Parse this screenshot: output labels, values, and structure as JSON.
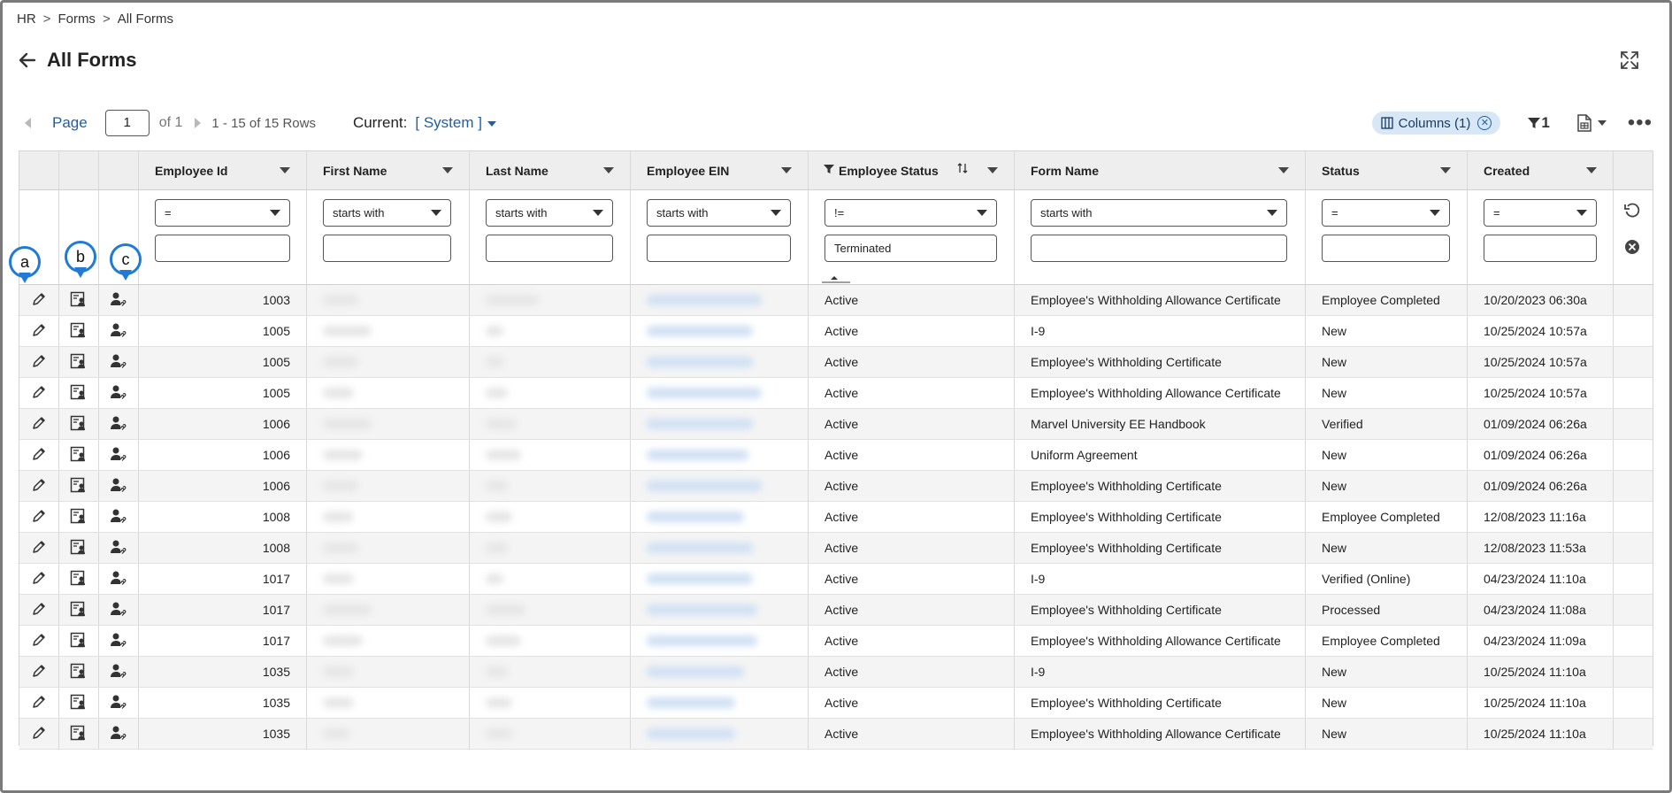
{
  "breadcrumb": [
    "HR",
    "Forms",
    "All Forms"
  ],
  "breadcrumb_sep": ">",
  "page_title": "All Forms",
  "pagination": {
    "page_label": "Page",
    "page_value": "1",
    "of_label": "of 1",
    "rows_label": "1 - 15 of 15 Rows"
  },
  "view": {
    "current_label": "Current:",
    "current_value": "[ System ]"
  },
  "toolbar_right": {
    "columns_chip": "Columns (1)",
    "filter_count": "1"
  },
  "columns": [
    {
      "key": "employee_id",
      "label": "Employee Id",
      "filter_op": "=",
      "filter_value": ""
    },
    {
      "key": "first_name",
      "label": "First Name",
      "filter_op": "starts with",
      "filter_value": ""
    },
    {
      "key": "last_name",
      "label": "Last Name",
      "filter_op": "starts with",
      "filter_value": ""
    },
    {
      "key": "employee_ein",
      "label": "Employee EIN",
      "filter_op": "starts with",
      "filter_value": ""
    },
    {
      "key": "employee_status",
      "label": "Employee Status",
      "filter_op": "!=",
      "filter_value": "Terminated"
    },
    {
      "key": "form_name",
      "label": "Form Name",
      "filter_op": "starts with",
      "filter_value": ""
    },
    {
      "key": "status",
      "label": "Status",
      "filter_op": "=",
      "filter_value": ""
    },
    {
      "key": "created",
      "label": "Created",
      "filter_op": "=",
      "filter_value": ""
    }
  ],
  "callouts": [
    "a",
    "b",
    "c"
  ],
  "icons": {
    "action_1": "pencil-icon",
    "action_2": "employee-form-icon",
    "action_3": "user-link-icon"
  },
  "rows": [
    {
      "employee_id": "1003",
      "employee_status": "Active",
      "form_name": "Employee's Withholding Allowance Certificate",
      "status": "Employee Completed",
      "created": "10/20/2023 06:30a"
    },
    {
      "employee_id": "1005",
      "employee_status": "Active",
      "form_name": "I-9",
      "status": "New",
      "created": "10/25/2024 10:57a"
    },
    {
      "employee_id": "1005",
      "employee_status": "Active",
      "form_name": "Employee's Withholding Certificate",
      "status": "New",
      "created": "10/25/2024 10:57a"
    },
    {
      "employee_id": "1005",
      "employee_status": "Active",
      "form_name": "Employee's Withholding Allowance Certificate",
      "status": "New",
      "created": "10/25/2024 10:57a"
    },
    {
      "employee_id": "1006",
      "employee_status": "Active",
      "form_name": "Marvel University EE Handbook",
      "status": "Verified",
      "created": "01/09/2024 06:26a"
    },
    {
      "employee_id": "1006",
      "employee_status": "Active",
      "form_name": "Uniform Agreement",
      "status": "New",
      "created": "01/09/2024 06:26a"
    },
    {
      "employee_id": "1006",
      "employee_status": "Active",
      "form_name": "Employee's Withholding Certificate",
      "status": "New",
      "created": "01/09/2024 06:26a"
    },
    {
      "employee_id": "1008",
      "employee_status": "Active",
      "form_name": "Employee's Withholding Certificate",
      "status": "Employee Completed",
      "created": "12/08/2023 11:16a"
    },
    {
      "employee_id": "1008",
      "employee_status": "Active",
      "form_name": "Employee's Withholding Certificate",
      "status": "New",
      "created": "12/08/2023 11:53a"
    },
    {
      "employee_id": "1017",
      "employee_status": "Active",
      "form_name": "I-9",
      "status": "Verified (Online)",
      "created": "04/23/2024 11:10a"
    },
    {
      "employee_id": "1017",
      "employee_status": "Active",
      "form_name": "Employee's Withholding Certificate",
      "status": "Processed",
      "created": "04/23/2024 11:08a"
    },
    {
      "employee_id": "1017",
      "employee_status": "Active",
      "form_name": "Employee's Withholding Allowance Certificate",
      "status": "Employee Completed",
      "created": "04/23/2024 11:09a"
    },
    {
      "employee_id": "1035",
      "employee_status": "Active",
      "form_name": "I-9",
      "status": "New",
      "created": "10/25/2024 11:10a"
    },
    {
      "employee_id": "1035",
      "employee_status": "Active",
      "form_name": "Employee's Withholding Certificate",
      "status": "New",
      "created": "10/25/2024 11:10a"
    },
    {
      "employee_id": "1035",
      "employee_status": "Active",
      "form_name": "Employee's Withholding Allowance Certificate",
      "status": "New",
      "created": "10/25/2024 11:10a"
    }
  ],
  "colors": {
    "accent": "#1f5fa8",
    "callout": "#1f7ad8",
    "header_bg": "#eeeeee",
    "chip_bg": "#d7e7f6"
  }
}
